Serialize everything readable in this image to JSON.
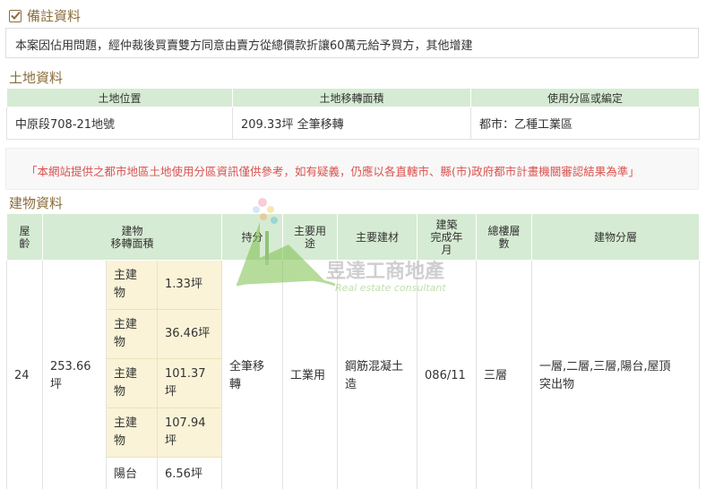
{
  "remarks": {
    "title": "備註資料",
    "text": "本案因佔用問題，經仲裁後買賣雙方同意由賣方從總價款折讓60萬元給予買方，其他增建"
  },
  "land": {
    "title": "土地資料",
    "headers": [
      "土地位置",
      "土地移轉面積",
      "使用分區或編定"
    ],
    "row": [
      "中原段708-21地號",
      "209.33坪 全筆移轉",
      "都市：乙種工業區"
    ]
  },
  "notice": "「本網站提供之都市地區土地使用分區資訊僅供參考，如有疑義，仍應以各直轄市、縣(市)政府都市計畫機關審認結果為準」",
  "building": {
    "title": "建物資料",
    "headers": {
      "age": "屋\n齡",
      "area": "建物\n移轉面積",
      "share": "持分",
      "usage": "主要用\n途",
      "material": "主要建材",
      "built": "建築\n完成年\n月",
      "floors": "總樓層\n數",
      "layers": "建物分層"
    },
    "row": {
      "age": "24",
      "area": "253.66\n坪",
      "share": "全筆移\n轉",
      "usage": "工業用",
      "material": "鋼筋混凝土\n造",
      "built": "086/11",
      "floors": "三層",
      "layers": "一層,二層,三層,陽台,屋頂\n突出物"
    },
    "sub_areas": [
      {
        "label": "主建\n物",
        "value": "1.33坪"
      },
      {
        "label": "主建\n物",
        "value": "36.46坪"
      },
      {
        "label": "主建\n物",
        "value": "101.37\n坪"
      },
      {
        "label": "主建\n物",
        "value": "107.94\n坪"
      },
      {
        "label": "陽台",
        "value": "6.56坪"
      }
    ]
  },
  "watermark": {
    "brand": "昱達工商地產",
    "tagline": "Real estate consultant"
  }
}
